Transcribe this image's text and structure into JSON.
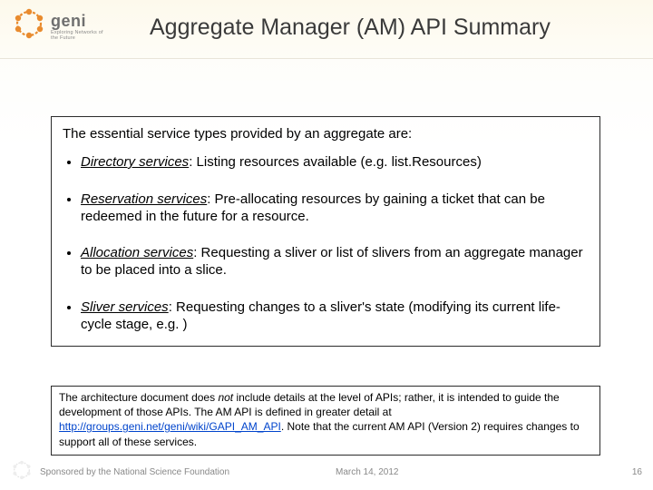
{
  "logo": {
    "brand": "geni",
    "tagline": "Exploring Networks of the Future"
  },
  "title": "Aggregate Manager (AM) API Summary",
  "content": {
    "intro": "The essential service types provided by an aggregate are:",
    "services": [
      {
        "name": "Directory services",
        "desc": ": Listing resources available (e.g. list.Resources)"
      },
      {
        "name": "Reservation services",
        "desc": ": Pre-allocating resources by gaining a ticket that can be redeemed in the future for a resource."
      },
      {
        "name": "Allocation services",
        "desc": ": Requesting a sliver or list of slivers from an aggregate manager to be placed into a slice."
      },
      {
        "name": "Sliver services",
        "desc": ": Requesting changes to a sliver's state (modifying its current life-cycle stage, e.g. )"
      }
    ]
  },
  "note": {
    "pre": "The architecture document does ",
    "not": "not",
    "mid": " include details at the level of APIs; rather, it is intended to guide the development of those APIs. The AM API is defined in greater detail at ",
    "link": "http://groups.geni.net/geni/wiki/GAPI_AM_API",
    "post": ". Note that the current AM API (Version 2) requires changes to support all of these services."
  },
  "footer": {
    "sponsor": "Sponsored by the National Science Foundation",
    "date": "March 14, 2012",
    "page": "16"
  }
}
